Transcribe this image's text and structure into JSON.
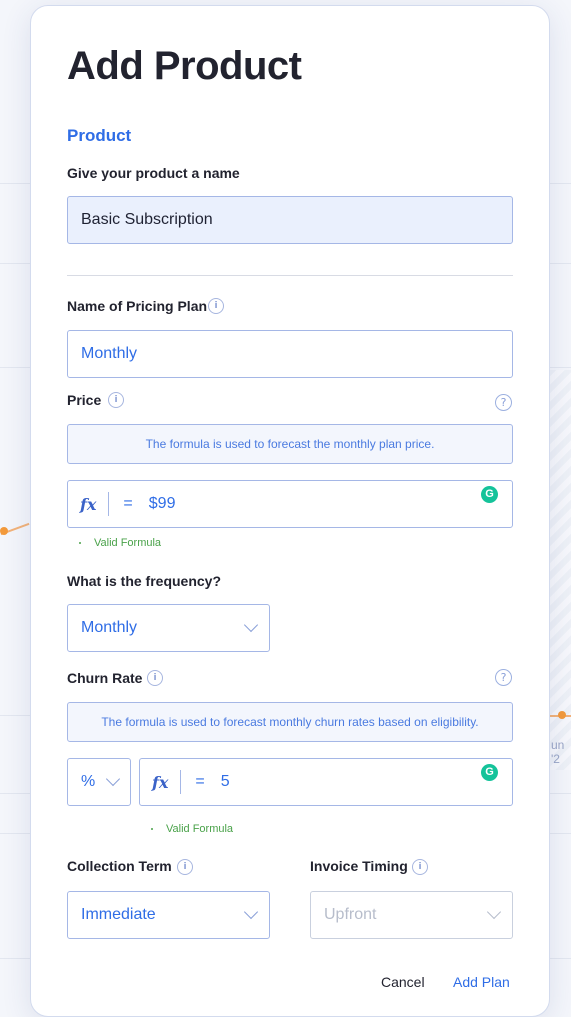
{
  "modal": {
    "title": "Add Product",
    "section_title": "Product",
    "product_name": {
      "label": "Give your product a name",
      "value": "Basic Subscription"
    },
    "pricing_plan": {
      "label": "Name of Pricing Plan",
      "value": "Monthly"
    },
    "price": {
      "label": "Price",
      "hint": "The formula is used to forecast the monthly plan price.",
      "formula_prefix": "fx",
      "equals": "=",
      "value": "$99",
      "validation": "Valid Formula"
    },
    "frequency": {
      "label": "What is the frequency?",
      "value": "Monthly"
    },
    "churn_rate": {
      "label": "Churn Rate",
      "hint": "The formula is used to forecast monthly churn rates based on eligibility.",
      "unit": "%",
      "formula_prefix": "fx",
      "equals": "=",
      "value": "5",
      "validation": "Valid Formula"
    },
    "collection_term": {
      "label": "Collection Term",
      "value": "Immediate"
    },
    "invoice_timing": {
      "label": "Invoice Timing",
      "value": "Upfront"
    },
    "footer": {
      "cancel": "Cancel",
      "add_plan": "Add Plan"
    }
  },
  "background": {
    "partial_label": "un '2"
  },
  "icons": {
    "info": "i",
    "help": "?",
    "grammarly": "G"
  },
  "colors": {
    "accent": "#2f6de6",
    "valid": "#4aa24a",
    "grammarly": "#15c39a"
  }
}
